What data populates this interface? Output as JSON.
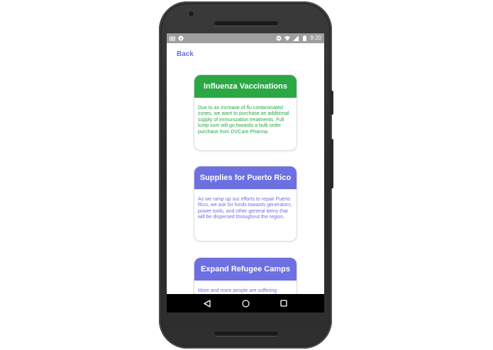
{
  "status_bar": {
    "time": "9:20",
    "left_icons": [
      "sim-icon",
      "notification-icon"
    ],
    "right_icons": [
      "do-not-disturb-icon",
      "wifi-icon",
      "signal-icon",
      "battery-icon"
    ]
  },
  "header": {
    "back_label": "Back"
  },
  "cards": [
    {
      "title": "Influenza Vaccinations",
      "description": "Due to an increase of flu contaminated zones, we want to purchase an additional supply of immunization treatments. Full lump sum will go towards a bulk order purchase from DVCare Pharma.",
      "header_color": "#2aa844",
      "text_color": "#2aa844"
    },
    {
      "title": "Supplies for Puerto Rico",
      "description": "As we ramp up our efforts to repair Puerto Rico, we ask for funds towards generators, power tools, and other general items that will be dispersed throughout the region.",
      "header_color": "#6d70e0",
      "text_color": "#6d70e0"
    },
    {
      "title": "Expand Refugee Camps",
      "description": "More and more people are suffering",
      "header_color": "#6d70e0",
      "text_color": "#6d70e0"
    }
  ],
  "nav_bar": {
    "icons": [
      "back-triangle-icon",
      "home-circle-icon",
      "recents-square-icon"
    ]
  },
  "colors": {
    "accent": "#6d70e0",
    "success": "#2aa844",
    "status_bar": "#9e9e9e",
    "nav_bar": "#000000"
  }
}
